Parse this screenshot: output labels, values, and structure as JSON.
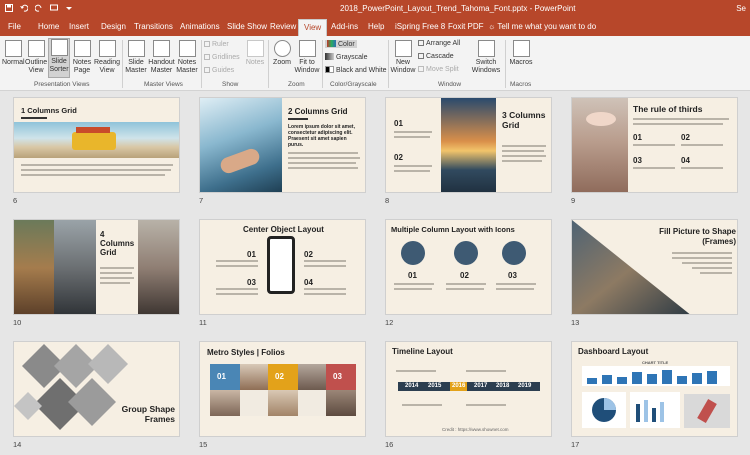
{
  "app": {
    "document_title": "2018_PowerPoint_Layout_Trend_Tahoma_Font.pptx",
    "app_name": "PowerPoint",
    "account": "Se"
  },
  "tabs": [
    "File",
    "Home",
    "Insert",
    "Design",
    "Transitions",
    "Animations",
    "Slide Show",
    "Review",
    "View",
    "Add-ins",
    "Help",
    "iSpring Free 8",
    "Foxit PDF"
  ],
  "active_tab": "View",
  "tell_me": "Tell me what you want to do",
  "ribbon": {
    "presentation_views": {
      "label": "Presentation Views",
      "items": [
        "Normal",
        "Outline View",
        "Slide Sorter",
        "Notes Page",
        "Reading View"
      ]
    },
    "master_views": {
      "label": "Master Views",
      "items": [
        "Slide Master",
        "Handout Master",
        "Notes Master"
      ]
    },
    "show": {
      "label": "Show",
      "items": [
        "Ruler",
        "Gridlines",
        "Guides"
      ],
      "notes": "Notes"
    },
    "zoom": {
      "label": "Zoom",
      "zoom": "Zoom",
      "fit": "Fit to Window"
    },
    "color": {
      "label": "Color/Grayscale",
      "items": [
        "Color",
        "Grayscale",
        "Black and White"
      ]
    },
    "window": {
      "label": "Window",
      "new_window": "New Window",
      "arrange_all": "Arrange All",
      "cascade": "Cascade",
      "move_split": "Move Split",
      "switch": "Switch Windows"
    },
    "macros": {
      "label": "Macros",
      "macros": "Macros"
    }
  },
  "slides": [
    {
      "num": "6",
      "title": "1 Columns Grid"
    },
    {
      "num": "7",
      "title": "2 Columns Grid",
      "body": "Lorem ipsum dolor sit amet, consectetur adipiscing elit. Praesent sit amet sapien purus."
    },
    {
      "num": "8",
      "title": "3 Columns Grid",
      "labels": [
        "01",
        "02"
      ]
    },
    {
      "num": "9",
      "title": "The rule of thirds",
      "labels": [
        "01",
        "02",
        "03",
        "04"
      ]
    },
    {
      "num": "10",
      "title": "4 Columns Grid"
    },
    {
      "num": "11",
      "title": "Center Object Layout",
      "labels": [
        "01",
        "02",
        "03",
        "04"
      ]
    },
    {
      "num": "12",
      "title": "Multiple Column Layout with Icons",
      "labels": [
        "01",
        "02",
        "03"
      ]
    },
    {
      "num": "13",
      "title": "Fill Picture to Shape (Frames)"
    },
    {
      "num": "14",
      "title": "Group Shape Frames"
    },
    {
      "num": "15",
      "title": "Metro Styles | Folios",
      "labels": [
        "01",
        "02",
        "03"
      ]
    },
    {
      "num": "16",
      "title": "Timeline Layout",
      "years": [
        "2014",
        "2015",
        "2016",
        "2017",
        "2018",
        "2019"
      ],
      "credit": "Credit : https://www.shownet.com"
    },
    {
      "num": "17",
      "title": "Dashboard Layout",
      "chart_title": "CHART TITLE"
    }
  ],
  "colors": {
    "accent": "#b7472a",
    "slide_bg": "#f6efe3",
    "icon_blue": "#3e5a73",
    "metro_blue": "#4a86b5",
    "metro_orange": "#e3a21a",
    "metro_red": "#c0504d"
  }
}
